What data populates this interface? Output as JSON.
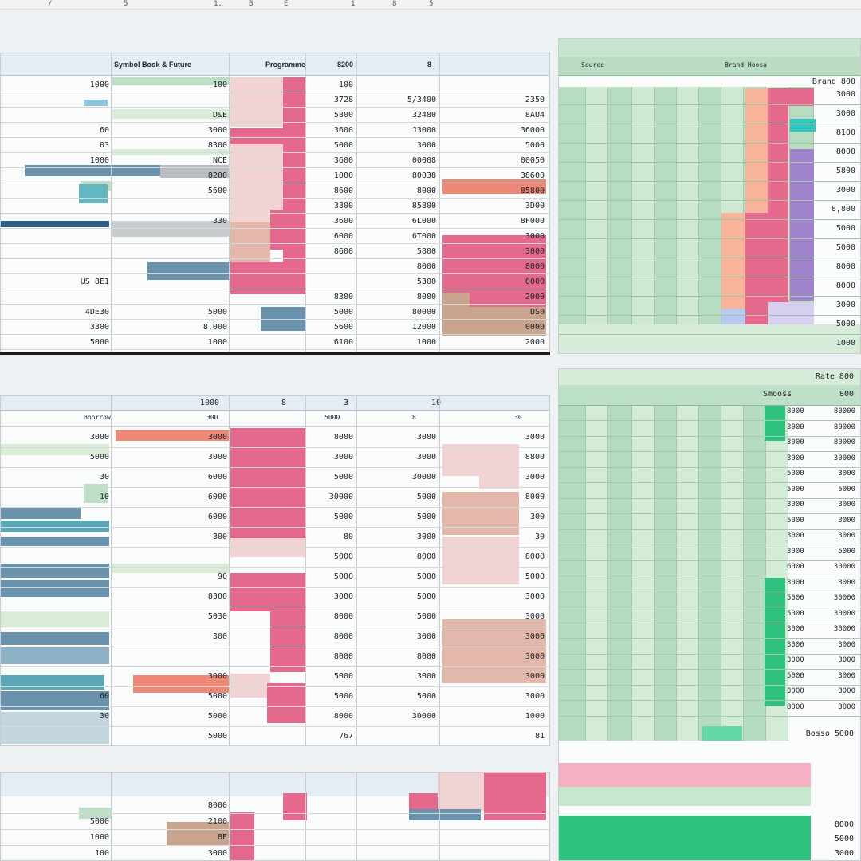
{
  "ruler": {
    "marks": [
      "/",
      "5",
      "1.",
      "B",
      "E",
      "1",
      "8",
      "5"
    ]
  },
  "panel_a": {
    "headers": [
      "Symbol Book & Future",
      "Programme",
      "8200",
      "8"
    ],
    "rows": [
      {
        "a": "1000",
        "b": "100",
        "c": "100",
        "d": "",
        "e": ""
      },
      {
        "a": "",
        "b": "",
        "c": "3728",
        "d": "5/3400",
        "e": "2350"
      },
      {
        "a": "",
        "b": "D&E",
        "c": "5800",
        "d": "32480",
        "e": "8AU4"
      },
      {
        "a": "60",
        "b": "3000",
        "c": "3600",
        "d": "J3000",
        "e": "36000"
      },
      {
        "a": "03",
        "b": "8300",
        "c": "5000",
        "d": "3000",
        "e": "5000"
      },
      {
        "a": "1000",
        "b": "NCE",
        "c": "3600",
        "d": "00008",
        "e": "00050"
      },
      {
        "a": "",
        "b": "8200",
        "c": "1000",
        "d": "80038",
        "e": "38600"
      },
      {
        "a": "",
        "b": "5600",
        "c": "8600",
        "d": "8000",
        "e": "85800"
      },
      {
        "a": "",
        "b": "",
        "c": "3300",
        "d": "85800",
        "e": "3D00"
      },
      {
        "a": "",
        "b": "330",
        "c": "3600",
        "d": "6L000",
        "e": "8F000"
      },
      {
        "a": "",
        "b": "",
        "c": "6000",
        "d": "6T000",
        "e": "3000"
      },
      {
        "a": "",
        "b": "",
        "c": "8600",
        "d": "5800",
        "e": "3000"
      },
      {
        "a": "",
        "b": "",
        "c": "",
        "d": "8000",
        "e": "8000"
      },
      {
        "a": "US 8E1",
        "b": "",
        "c": "",
        "d": "5300",
        "e": "0000"
      },
      {
        "a": "",
        "b": "",
        "c": "8300",
        "d": "8000",
        "e": "2000"
      },
      {
        "a": "4DE30",
        "b": "5000",
        "c": "5000",
        "d": "80000",
        "e": "DS0"
      },
      {
        "a": "3300",
        "b": "8,000",
        "c": "5600",
        "d": "12000",
        "e": "0000"
      },
      {
        "a": "5000",
        "b": "1000",
        "c": "6100",
        "d": "1000",
        "e": "2000"
      }
    ]
  },
  "panel_b": {
    "headers": [
      "",
      "1000",
      "8",
      "3",
      "10"
    ],
    "sub": [
      "Boorrow",
      "300",
      "5000",
      "8",
      "30"
    ],
    "rows": [
      {
        "a": "3000",
        "b": "3000",
        "c": "8000",
        "d": "3000",
        "e": "3000"
      },
      {
        "a": "5000",
        "b": "3000",
        "c": "3000",
        "d": "3000",
        "e": "8800"
      },
      {
        "a": "30",
        "b": "6000",
        "c": "5000",
        "d": "30000",
        "e": "3000"
      },
      {
        "a": "10",
        "b": "6000",
        "c": "30000",
        "d": "5000",
        "e": "8000"
      },
      {
        "a": "",
        "b": "6000",
        "c": "5000",
        "d": "5000",
        "e": "300"
      },
      {
        "a": "",
        "b": "300",
        "c": "80",
        "d": "3000",
        "e": "30"
      },
      {
        "a": "",
        "b": "",
        "c": "5000",
        "d": "8000",
        "e": "8000"
      },
      {
        "a": "",
        "b": "90",
        "c": "5000",
        "d": "5000",
        "e": "5000"
      },
      {
        "a": "",
        "b": "8300",
        "c": "3000",
        "d": "5000",
        "e": "3000"
      },
      {
        "a": "",
        "b": "5030",
        "c": "8000",
        "d": "5000",
        "e": "3000"
      },
      {
        "a": "",
        "b": "300",
        "c": "8000",
        "d": "3000",
        "e": "3000"
      },
      {
        "a": "",
        "b": "",
        "c": "8000",
        "d": "8000",
        "e": "3000"
      },
      {
        "a": "",
        "b": "3000",
        "c": "5000",
        "d": "3000",
        "e": "3000"
      },
      {
        "a": "60",
        "b": "5000",
        "c": "5000",
        "d": "5000",
        "e": "3000"
      },
      {
        "a": "30",
        "b": "5000",
        "c": "8000",
        "d": "30000",
        "e": "1000"
      },
      {
        "a": "",
        "b": "5000",
        "c": "767",
        "d": "",
        "e": "81"
      }
    ]
  },
  "panel_c": {
    "rows": [
      {
        "a": "",
        "b": "8000"
      },
      {
        "a": "5000",
        "b": "2100"
      },
      {
        "a": "1000",
        "b": "8E"
      },
      {
        "a": "100",
        "b": "3000"
      }
    ]
  },
  "panel_d": {
    "header_left": "Source",
    "header_right": "Brand Hoosa",
    "col_label": "Brand 800",
    "right_values": [
      "3000",
      "3000",
      "8100",
      "8000",
      "5800",
      "3000",
      "8,800",
      "5000",
      "5000",
      "8000",
      "8000",
      "3000",
      "5000",
      "1000"
    ],
    "purple_rows": 10
  },
  "panel_e": {
    "header": "Rate 800",
    "sub": [
      "Smooss",
      "800"
    ],
    "left_values": [
      "8000",
      "3000",
      "3000",
      "3000",
      "5000",
      "5000",
      "3000",
      "5000",
      "3000",
      "3000",
      "6000",
      "3000",
      "5000",
      "5000",
      "3000",
      "3000",
      "3000",
      "5000",
      "3000",
      "8000"
    ],
    "right_values": [
      "80000",
      "80000",
      "80000",
      "30000",
      "3000",
      "5000",
      "3000",
      "3000",
      "3000",
      "5000",
      "30000",
      "3000",
      "30000",
      "30000",
      "30000",
      "3000",
      "3000",
      "3000",
      "3000",
      "3000"
    ],
    "footer": "Bosso  5000",
    "bottom_right": [
      "8000",
      "5000",
      "3000"
    ]
  },
  "colors": {
    "pink": "#e4698d",
    "light_pink": "#f2d3d4",
    "salmon": "#ee8877",
    "green": "#bcdfc6",
    "light_green": "#d8ecd8",
    "teal": "#5aa7b8",
    "slate": "#6b92ad",
    "tan": "#c9a58f",
    "purple": "#9f83cb",
    "emerald": "#2fc27f"
  }
}
